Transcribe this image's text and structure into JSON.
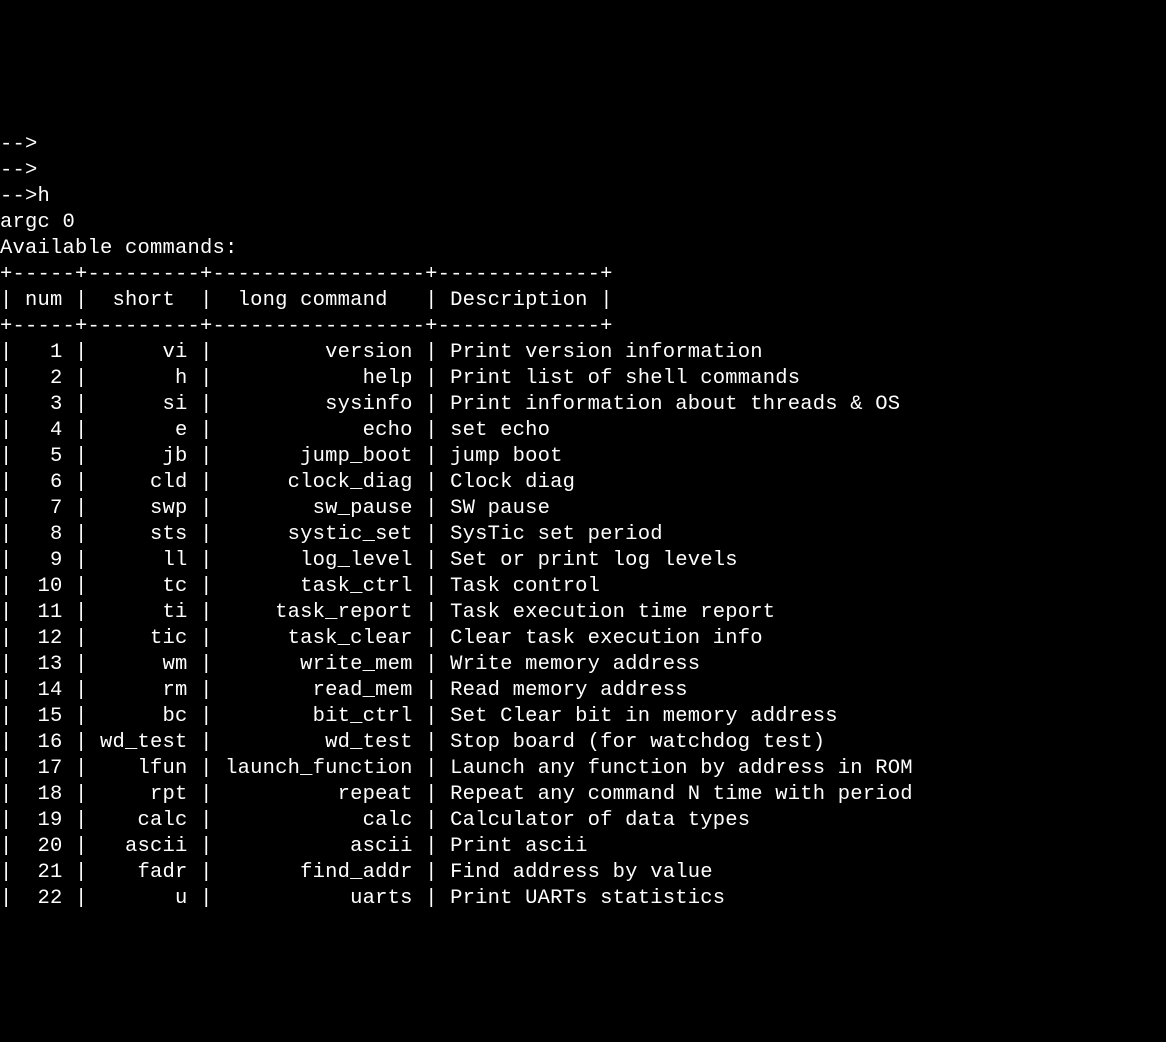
{
  "prompt_lines": [
    "-->",
    "-->",
    "-->h"
  ],
  "argc_line": "argc 0",
  "available_line": "Available commands:",
  "columns": {
    "num_width": 5,
    "short_width": 9,
    "long_width": 17,
    "desc_header_width": 13
  },
  "headers": {
    "num": "num",
    "short": "short",
    "long": "long command",
    "desc": "Description"
  },
  "rows": [
    {
      "num": 1,
      "short": "vi",
      "long": "version",
      "desc": "Print version information"
    },
    {
      "num": 2,
      "short": "h",
      "long": "help",
      "desc": "Print list of shell commands"
    },
    {
      "num": 3,
      "short": "si",
      "long": "sysinfo",
      "desc": "Print information about threads & OS"
    },
    {
      "num": 4,
      "short": "e",
      "long": "echo",
      "desc": "set echo"
    },
    {
      "num": 5,
      "short": "jb",
      "long": "jump_boot",
      "desc": "jump boot"
    },
    {
      "num": 6,
      "short": "cld",
      "long": "clock_diag",
      "desc": "Clock diag"
    },
    {
      "num": 7,
      "short": "swp",
      "long": "sw_pause",
      "desc": "SW pause"
    },
    {
      "num": 8,
      "short": "sts",
      "long": "systic_set",
      "desc": "SysTic set period"
    },
    {
      "num": 9,
      "short": "ll",
      "long": "log_level",
      "desc": "Set or print log levels"
    },
    {
      "num": 10,
      "short": "tc",
      "long": "task_ctrl",
      "desc": "Task control"
    },
    {
      "num": 11,
      "short": "ti",
      "long": "task_report",
      "desc": "Task execution time report"
    },
    {
      "num": 12,
      "short": "tic",
      "long": "task_clear",
      "desc": "Clear task execution info"
    },
    {
      "num": 13,
      "short": "wm",
      "long": "write_mem",
      "desc": "Write memory address"
    },
    {
      "num": 14,
      "short": "rm",
      "long": "read_mem",
      "desc": "Read memory address"
    },
    {
      "num": 15,
      "short": "bc",
      "long": "bit_ctrl",
      "desc": "Set Clear bit in memory address"
    },
    {
      "num": 16,
      "short": "wd_test",
      "long": "wd_test",
      "desc": "Stop board (for watchdog test)"
    },
    {
      "num": 17,
      "short": "lfun",
      "long": "launch_function",
      "desc": "Launch any function by address in ROM"
    },
    {
      "num": 18,
      "short": "rpt",
      "long": "repeat",
      "desc": "Repeat any command N time with period"
    },
    {
      "num": 19,
      "short": "calc",
      "long": "calc",
      "desc": "Calculator of data types"
    },
    {
      "num": 20,
      "short": "ascii",
      "long": "ascii",
      "desc": "Print ascii"
    },
    {
      "num": 21,
      "short": "fadr",
      "long": "find_addr",
      "desc": "Find address by value"
    },
    {
      "num": 22,
      "short": "u",
      "long": "uarts",
      "desc": "Print UARTs statistics"
    }
  ]
}
